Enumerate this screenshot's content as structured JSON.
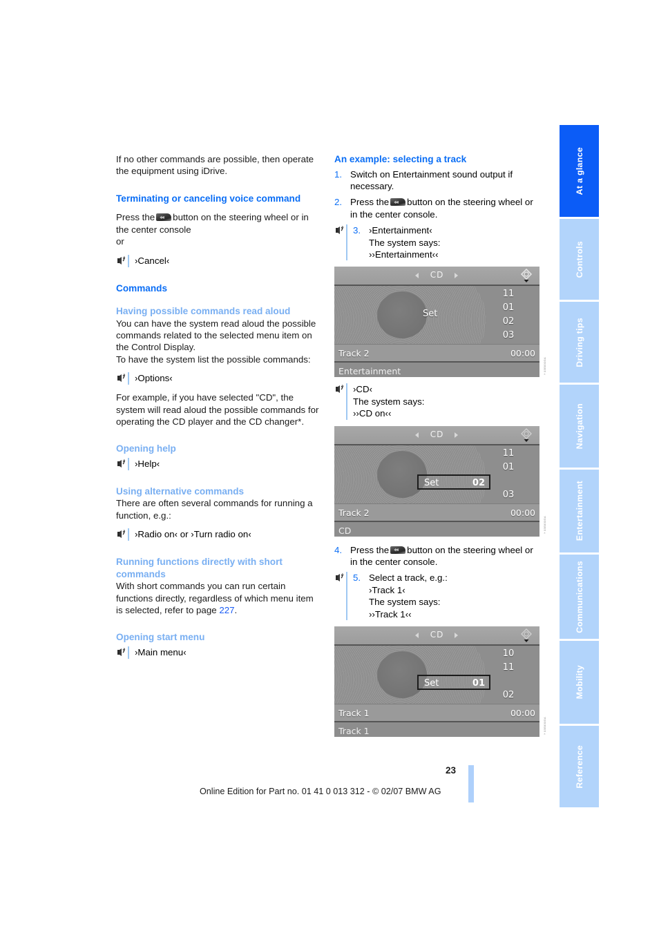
{
  "document": {
    "page_number": "23",
    "footer_text": "Online Edition for Part no. 01 41 0 013 312 - © 02/07 BMW AG"
  },
  "left_column": {
    "intro": "If no other commands are possible, then operate the equipment using iDrive.",
    "heading_terminating": "Terminating or canceling voice command",
    "terminating_text_before": "Press the",
    "terminating_text_after": "button on the steering wheel or in the center console",
    "or_word": "or",
    "cancel_command": "›Cancel‹",
    "heading_commands": "Commands",
    "heading_read_aloud": "Having possible commands read aloud",
    "read_aloud_text": "You can have the system read aloud the possible commands related to the selected menu item on the Control Display.",
    "read_aloud_text2": "To have the system list the possible commands:",
    "options_command": "›Options‹",
    "example_cd_text": "For example, if you have selected \"CD\", the system will read aloud the possible commands for operating the CD player and the CD changer*.",
    "heading_opening_help": "Opening help",
    "help_command": "›Help‹",
    "heading_alternative": "Using alternative commands",
    "alternative_text": "There are often several commands for running a function, e.g.:",
    "radio_command": "›Radio on‹  or ›Turn radio on‹",
    "heading_short_commands": "Running functions directly with short commands",
    "short_commands_text_a": "With short commands you can run certain functions directly, regardless of which menu item is selected, refer to page ",
    "short_commands_pageref": "227",
    "short_commands_text_b": ".",
    "heading_start_menu": "Opening start menu",
    "main_menu_command": "›Main menu‹"
  },
  "right_column": {
    "heading_example": "An example: selecting a track",
    "steps": [
      {
        "number": "1.",
        "text": "Switch on Entertainment sound output if necessary."
      },
      {
        "number": "2.",
        "text_before": "Press the",
        "text_after": "button on the steering wheel or in the center console."
      },
      {
        "number": "3.",
        "command": "›Entertainment‹",
        "says_label": "The system says:",
        "says_text": "››Entertainment‹‹"
      },
      {
        "number": "4.",
        "text_before": "Press the",
        "text_after": "button on the steering wheel or in the center console."
      },
      {
        "number": "5.",
        "text": "Select a track, e.g.:",
        "command": "›Track 1‹",
        "says_label": "The system says:",
        "says_text": "››Track 1‹‹"
      }
    ],
    "cd_voice_note": {
      "command": "›CD‹",
      "says_label": "The system says:",
      "says_text": "››CD on‹‹"
    }
  },
  "displays": [
    {
      "title": "CD",
      "set_label": "Set",
      "tracks": [
        "11",
        "01",
        "02",
        "03"
      ],
      "selected_index": -1,
      "selected_track": "",
      "track_label": "Track 2",
      "time": "00:00",
      "status": "Entertainment",
      "side_code": "×03E830GA"
    },
    {
      "title": "CD",
      "set_label": "Set",
      "tracks": [
        "11",
        "01",
        "02",
        "03"
      ],
      "selected_index": 2,
      "selected_track": "02",
      "track_label": "Track 2",
      "time": "00:00",
      "status": "CD",
      "side_code": "×03E830GA"
    },
    {
      "title": "CD",
      "set_label": "Set",
      "tracks": [
        "10",
        "11",
        "01",
        "02"
      ],
      "selected_index": 2,
      "selected_track": "01",
      "track_label": "Track 1",
      "time": "00:00",
      "status": "Track 1",
      "side_code": "×03E830GA"
    }
  ],
  "tabs": [
    {
      "label": "At a glance",
      "active": true
    },
    {
      "label": "Controls",
      "active": false
    },
    {
      "label": "Driving tips",
      "active": false
    },
    {
      "label": "Navigation",
      "active": false
    },
    {
      "label": "Entertainment",
      "active": false
    },
    {
      "label": "Communications",
      "active": false
    },
    {
      "label": "Mobility",
      "active": false
    },
    {
      "label": "Reference",
      "active": false
    }
  ],
  "colors": {
    "accent_blue": "#0b6ef5",
    "light_blue": "#79aff2",
    "tab_inactive": "#b2d4fb",
    "tab_active": "#0b5cf7"
  }
}
